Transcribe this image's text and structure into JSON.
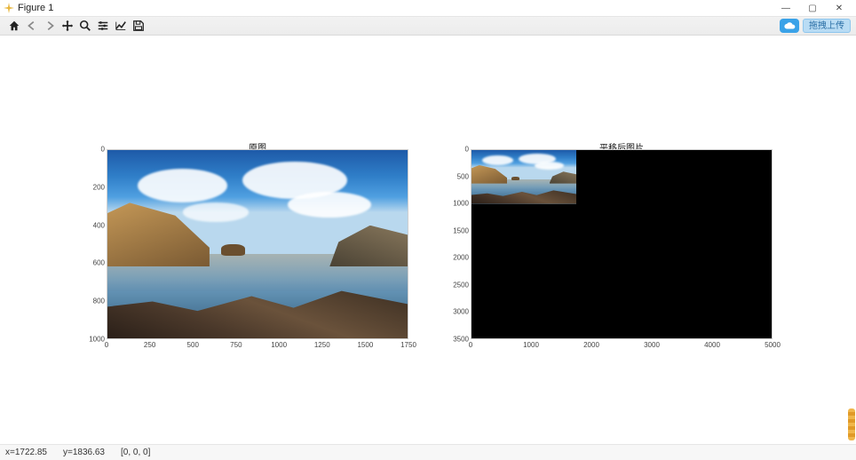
{
  "window": {
    "title": "Figure 1",
    "controls": {
      "minimize": "—",
      "maximize": "▢",
      "close": "✕"
    }
  },
  "toolbar": {
    "items": [
      {
        "name": "home-icon"
      },
      {
        "name": "back-icon"
      },
      {
        "name": "forward-icon"
      },
      {
        "name": "pan-icon"
      },
      {
        "name": "zoom-icon"
      },
      {
        "name": "configure-icon"
      },
      {
        "name": "edit-axes-icon"
      },
      {
        "name": "save-icon"
      }
    ],
    "upload_label": "拖拽上传"
  },
  "status": {
    "x": "x=1722.85",
    "y": "y=1836.63",
    "pixel": "[0, 0, 0]"
  },
  "chart_data": [
    {
      "type": "image",
      "title": "原图",
      "xlim": [
        0,
        1750
      ],
      "ylim": [
        0,
        1000
      ],
      "xticks": [
        0,
        250,
        500,
        750,
        1000,
        1250,
        1500,
        1750
      ],
      "yticks": [
        0,
        200,
        400,
        600,
        800,
        1000
      ],
      "image": {
        "description": "landscape photo: blue sky with clouds, brown cliffs left, calm lake/sea, rocky foreground",
        "extent_x": [
          0,
          1750
        ],
        "extent_y": [
          0,
          1000
        ]
      }
    },
    {
      "type": "image",
      "title": "平移后图片",
      "xlim": [
        0,
        5000
      ],
      "ylim": [
        0,
        3500
      ],
      "xticks": [
        0,
        1000,
        2000,
        3000,
        4000,
        5000
      ],
      "yticks": [
        0,
        500,
        1000,
        1500,
        2000,
        2500,
        3000,
        3500
      ],
      "image": {
        "description": "same landscape placed at top-left inside much larger black canvas (translated image)",
        "content_extent_x": [
          0,
          1750
        ],
        "content_extent_y": [
          0,
          1000
        ],
        "background": "#000000"
      }
    }
  ]
}
